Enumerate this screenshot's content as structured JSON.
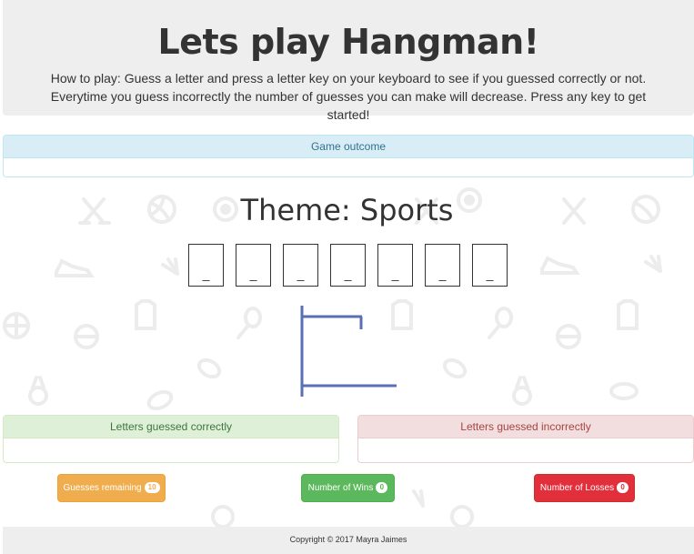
{
  "header": {
    "title": "Lets play Hangman!",
    "instructions": "How to play: Guess a letter and press a letter key on your keyboard to see if you guessed correctly or not. Everytime you guess incorrectly the number of guesses you can make will decrease. Press any key to get started!"
  },
  "outcome_panel": {
    "heading": "Game outcome",
    "body": ""
  },
  "theme": "Theme: Sports",
  "word_slots": [
    "_",
    "_",
    "_",
    "_",
    "_",
    "_",
    "_"
  ],
  "correct_panel": {
    "heading": "Letters guessed correctly",
    "body": ""
  },
  "incorrect_panel": {
    "heading": "Letters guessed incorrectly",
    "body": ""
  },
  "stats": {
    "remaining_label": "Guesses remaining",
    "remaining_value": "10",
    "wins_label": "Number of Wins",
    "wins_value": "0",
    "losses_label": "Number of Losses",
    "losses_value": "0"
  },
  "footer": {
    "copyright": "Copyright © 2017 Mayra Jaimes"
  },
  "colors": {
    "remaining": "#f0ad4e",
    "wins": "#5cb85c",
    "losses": "#e22f3c",
    "gallows": "#5a6fb5",
    "pattern": "#ececec"
  },
  "background_icons": [
    "hockey-icon",
    "volleyball-icon",
    "soccer-ball-icon",
    "sneaker-icon",
    "shuttlecock-icon",
    "jersey-icon",
    "tennis-racket-icon",
    "basketball-icon",
    "football-icon",
    "medal-icon",
    "puck-icon"
  ]
}
